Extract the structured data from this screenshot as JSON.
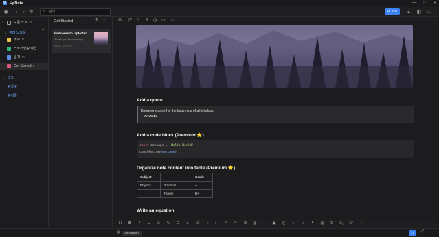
{
  "app": {
    "title": "UpNote",
    "logo": "U"
  },
  "window_controls": [
    "—",
    "□",
    "✕"
  ],
  "toolbar": {
    "search_placeholder": "검색",
    "new_note_label": "새 노트",
    "icons": [
      "sidebar-toggle-icon",
      "back-icon",
      "forward-icon",
      "refresh-icon",
      "lock-icon",
      "layout-icon",
      "window-icon",
      "more-icon"
    ]
  },
  "sidebar": {
    "all_notes": "모든 노트",
    "all_notes_count": "23",
    "notebooks_header": "여러 노트북",
    "notebooks": [
      {
        "label": "메모",
        "count": "11",
        "color": "#e8c34a"
      },
      {
        "label": "스트리밍링 작업...",
        "count": "",
        "color": "#27b37a"
      },
      {
        "label": "일기",
        "count": "10",
        "color": "#5a8de8"
      },
      {
        "label": "Get Started",
        "count": "1",
        "color": "#d85a7a"
      }
    ],
    "tags_label": "태그",
    "templates_label": "템플릿",
    "trash_label": "휴지통"
  },
  "notelist": {
    "title": "Get Started",
    "card": {
      "title": "Welcome to UpNote!",
      "snippet": "Thank you for choosing ...",
      "date": "5월 16, 오후 3:35"
    }
  },
  "editor": {
    "h_quote": "Add a quote",
    "quote_text": "Knowing yourself is the beginning of all wisdom.",
    "quote_author": "—Aristotle",
    "h_code": "Add a code block (Premium ⭐)",
    "code_line1_kw": "const",
    "code_line1_mid": " message = ",
    "code_line1_str": "'Hello World'",
    "code_line2_fn": "console.log(",
    "code_line2_arg": "message",
    "code_line2_end": ")",
    "h_table": "Organize note content into table (Premium ⭐)",
    "table": {
      "headers": [
        "Subject",
        "",
        "Grade"
      ],
      "rows": [
        [
          "Physics",
          "Practical",
          "A"
        ],
        [
          "",
          "Theory",
          "B+"
        ]
      ]
    },
    "h_equation": "Write an equation"
  },
  "statusbar": {
    "notebook_tag": "Get Started",
    "font_button": "Aa"
  }
}
